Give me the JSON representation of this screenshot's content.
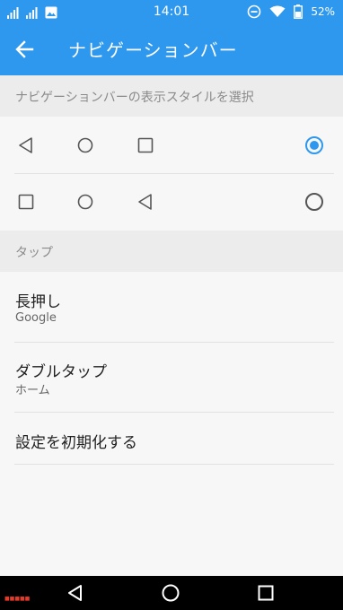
{
  "status_bar": {
    "time": "14:01",
    "battery": "52%",
    "icons_left": [
      "signal-icon",
      "signal-icon",
      "image-icon"
    ],
    "icons_right": [
      "do-not-disturb-icon",
      "wifi-icon",
      "battery-icon"
    ]
  },
  "app_bar": {
    "title": "ナビゲーションバー",
    "back_icon": "arrow-left-icon"
  },
  "style_section": {
    "header": "ナビゲーションバーの表示スタイルを選択",
    "options": [
      {
        "icons": [
          "back-triangle-icon",
          "home-circle-icon",
          "recents-square-icon"
        ],
        "selected": true
      },
      {
        "icons": [
          "recents-square-icon",
          "home-circle-icon",
          "back-triangle-icon"
        ],
        "selected": false
      }
    ]
  },
  "tap_section": {
    "header": "タップ",
    "items": [
      {
        "title": "長押し",
        "subtitle": "Google"
      },
      {
        "title": "ダブルタップ",
        "subtitle": "ホーム"
      },
      {
        "title": "設定を初期化する"
      }
    ]
  },
  "colors": {
    "accent": "#2e98ee",
    "background": "#f7f7f7",
    "section_header_bg": "#ececec"
  }
}
